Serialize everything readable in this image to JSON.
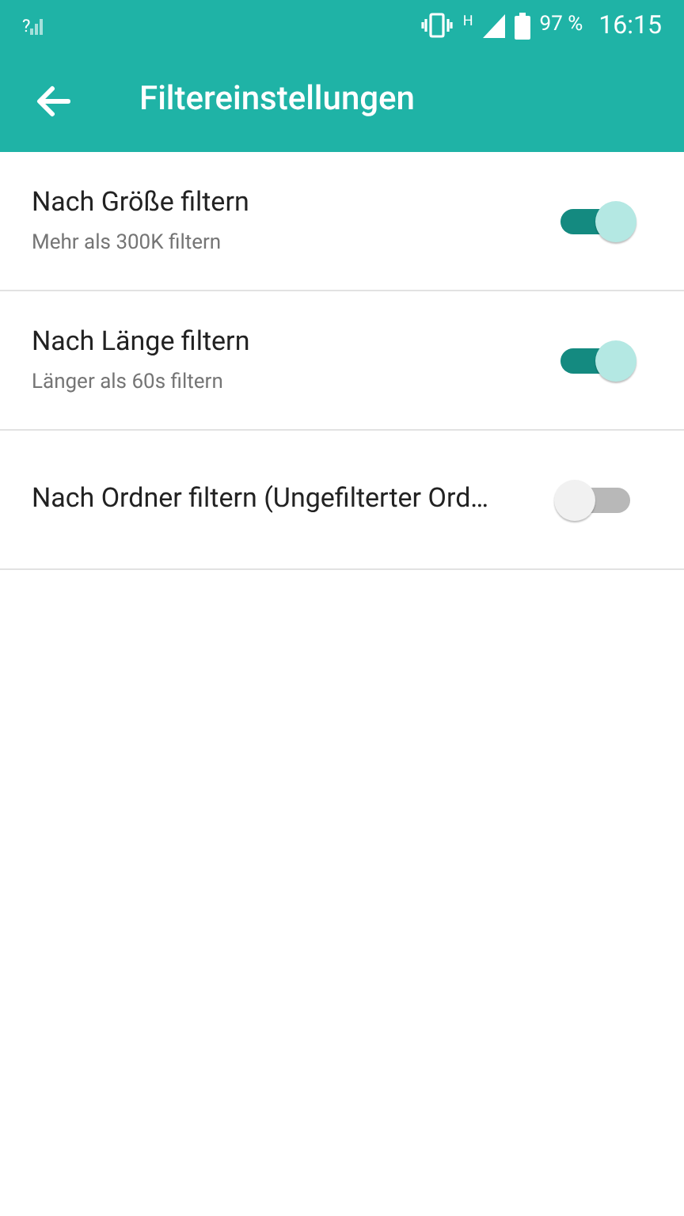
{
  "status_bar": {
    "signal_label": "?",
    "network_type": "H",
    "battery": "97 %",
    "time": "16:15"
  },
  "toolbar": {
    "title": "Filtereinstellungen"
  },
  "settings": [
    {
      "title": "Nach Größe filtern",
      "summary": "Mehr als 300K filtern",
      "on": true
    },
    {
      "title": "Nach Länge filtern",
      "summary": "Länger als 60s filtern",
      "on": true
    },
    {
      "title": "Nach Ordner filtern (Ungefilterter Ord…",
      "on": false
    }
  ]
}
